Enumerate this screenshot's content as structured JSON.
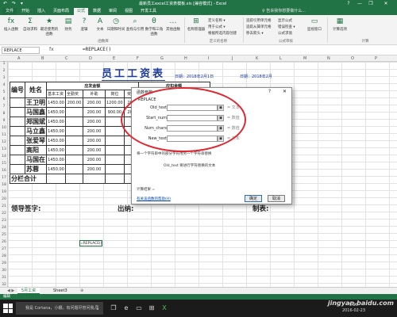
{
  "window": {
    "title": "最新员工excel工资表模板.xls [兼容模式] - Excel",
    "quick_access": "↶ ↷ ▾",
    "buttons": [
      "?",
      "—",
      "❐",
      "✕"
    ]
  },
  "ribbon": {
    "tabs": [
      "文件",
      "开始",
      "插入",
      "页面布局",
      "公式",
      "数据",
      "审阅",
      "视图",
      "开发工具"
    ],
    "active_tab": "公式",
    "tell_me": "♀ 告诉我你想要做什么...",
    "buttons": [
      {
        "label": "插入函数",
        "icon": "fx-icon",
        "glyph": "fx"
      },
      {
        "label": "自动求和",
        "icon": "sigma-icon",
        "glyph": "Σ"
      },
      {
        "label": "最近使用的函数",
        "icon": "star-icon",
        "glyph": "★"
      },
      {
        "label": "财务",
        "icon": "book-icon",
        "glyph": "▤"
      },
      {
        "label": "逻辑",
        "icon": "book-icon",
        "glyph": "?"
      },
      {
        "label": "文本",
        "icon": "book-icon",
        "glyph": "A"
      },
      {
        "label": "日期和时间",
        "icon": "clock-icon",
        "glyph": "◷"
      },
      {
        "label": "查找与引用",
        "icon": "book-icon",
        "glyph": "⌕"
      },
      {
        "label": "数学和三角函数",
        "icon": "book-icon",
        "glyph": "θ"
      },
      {
        "label": "其他函数",
        "icon": "book-icon",
        "glyph": "…"
      },
      {
        "label": "名称管理器",
        "icon": "tag-icon",
        "glyph": "⊞"
      }
    ],
    "name_group_items": [
      "定义名称 ▾",
      "用于公式 ▾",
      "根据所选内容创建"
    ],
    "audit_group_items": [
      "追踪引用单元格",
      "追踪从属单元格",
      "移去箭头 ▾",
      "显示公式",
      "错误检查 ▾",
      "公式求值"
    ],
    "watch_window": "监视窗口",
    "calc_button": "计算选项",
    "groups": [
      "函数库",
      "定义的名称",
      "公式审核",
      "计算"
    ]
  },
  "formula_bar": {
    "name_box": "REPLACE",
    "fx": "fx",
    "formula": "=REPLACE()"
  },
  "grid": {
    "columns": [
      "A",
      "B",
      "C",
      "D",
      "E",
      "F",
      "G",
      "H",
      "I",
      "J",
      "K",
      "L",
      "M",
      "N",
      "O",
      "P"
    ],
    "rows": [
      "1",
      "2",
      "3",
      "4",
      "5",
      "6",
      "7",
      "8",
      "9",
      "10",
      "11",
      "12",
      "13",
      "14",
      "15",
      "16",
      "17",
      "18",
      "19",
      "20",
      "21",
      "22",
      "23",
      "24",
      "25",
      "26",
      "27",
      "28",
      "29",
      "30",
      "31",
      "32"
    ]
  },
  "sheet": {
    "title": "员工工资表",
    "date_label": "日期：2018年2月1日",
    "date_label2": "日期：2018年2月",
    "header_left": "应发金额",
    "header_right": "应扣金额",
    "col_no": "编号",
    "col_name": "姓名",
    "sub_headers": [
      "基本工资",
      "全勤奖",
      "补助",
      "岗位",
      "奖金"
    ],
    "employees": [
      {
        "name": "王卫明",
        "vals": [
          "1450.00",
          "200.00",
          "200.00",
          "1200.00",
          "200"
        ]
      },
      {
        "name": "马国鑫",
        "vals": [
          "1450.00",
          "",
          "200.00",
          "900.00",
          "200"
        ]
      },
      {
        "name": "郑国斌",
        "vals": [
          "1450.00",
          "",
          "200.00",
          "",
          ""
        ]
      },
      {
        "name": "马立鑫",
        "vals": [
          "1450.00",
          "",
          "200.00",
          "",
          ""
        ]
      },
      {
        "name": "张爱琴",
        "vals": [
          "1450.00",
          "",
          "200.00",
          "",
          ""
        ]
      },
      {
        "name": "高阳",
        "vals": [
          "1450.00",
          "",
          "200.00",
          "",
          ""
        ]
      },
      {
        "name": "马国在",
        "vals": [
          "1450.00",
          "",
          "200.00",
          "",
          ""
        ]
      },
      {
        "name": "苏蓉",
        "vals": [
          "1450.00",
          "",
          "200.00",
          "",
          ""
        ]
      }
    ],
    "subtotal": "分栏合计",
    "total": "合计",
    "leader_sign": "领导签字:",
    "cashier": "出纳:",
    "maker": "制表:",
    "active_cell_text": "=REPLACE()"
  },
  "dialog": {
    "title": "函数参数",
    "help": "?",
    "close": "✕",
    "function_name": "REPLACE",
    "args": [
      {
        "label": "Old_text",
        "value": "",
        "result": "= 文本"
      },
      {
        "label": "Start_num",
        "value": "",
        "result": "= 数值"
      },
      {
        "label": "Num_chars",
        "value": "",
        "result": "= 数值"
      },
      {
        "label": "New_text",
        "value": "",
        "result": "= 文本"
      }
    ],
    "description": "将一个字符串中的部分字符用另一个字符串替换",
    "param_desc": "Old_text  要进行字符替换的文本",
    "result_label": "计算结果 =",
    "help_link": "有关该函数的帮助(H)",
    "ok": "确定",
    "cancel": "取消"
  },
  "sheet_tabs": [
    "5月工资",
    "Sheet3",
    "⊕"
  ],
  "status": {
    "mode": "编辑"
  },
  "taskbar": {
    "cortana": "我是 Cortana，小娜。有问题尽管问我。",
    "time": "9:29",
    "date": "2016-02-23",
    "watermark": "jingyan.baidu.com"
  },
  "colors": {
    "excel_green": "#217346",
    "annotation_red": "#e0262e",
    "title_blue": "#1a3a9a"
  }
}
